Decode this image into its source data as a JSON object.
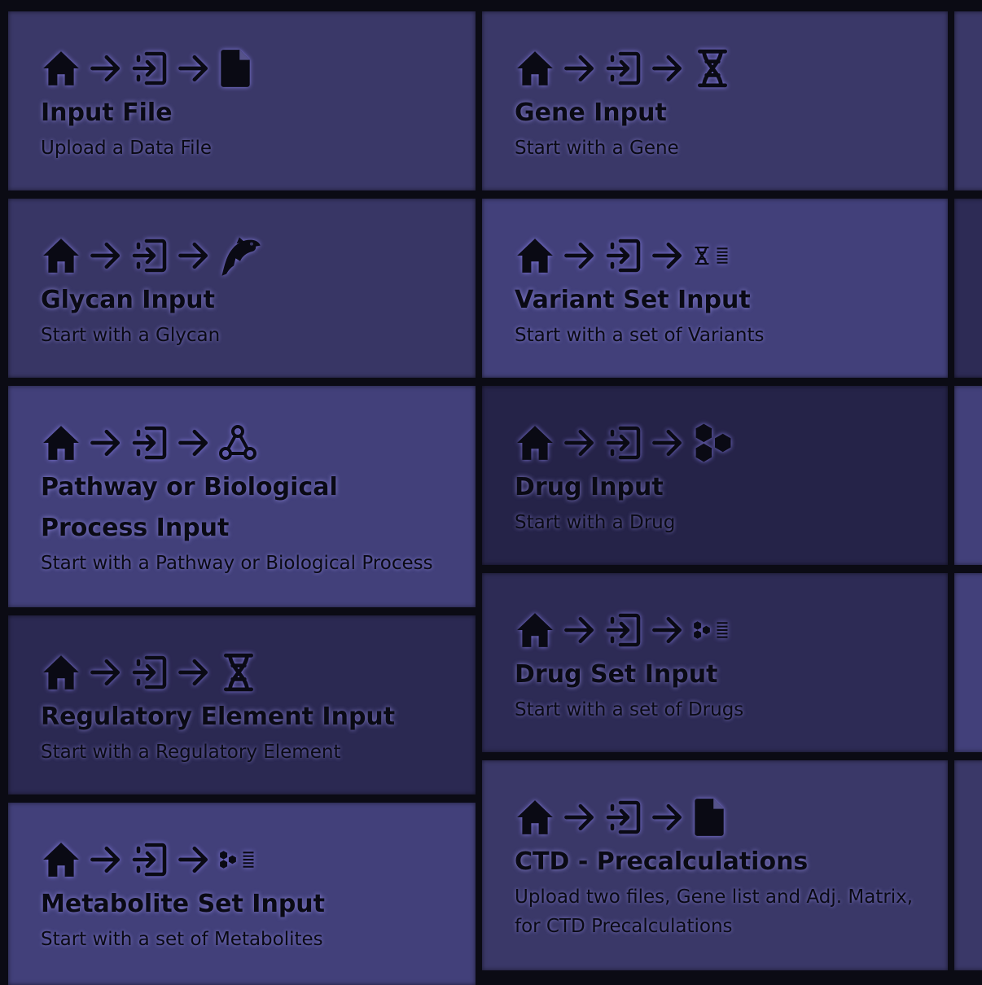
{
  "cards": [
    {
      "title": "Input File",
      "subtitle": "Upload a Data File",
      "icon": "file-icon"
    },
    {
      "title": "Glycan Input",
      "subtitle": "Start with a Glycan",
      "icon": "dolphin-icon"
    },
    {
      "title": "Pathway or Biological Process Input",
      "subtitle": "Start with a Pathway or Biological Process",
      "icon": "pathway-icon"
    },
    {
      "title": "Regulatory Element Input",
      "subtitle": "Start with a Regulatory Element",
      "icon": "dna-icon"
    },
    {
      "title": "Metabolite Set Input",
      "subtitle": "Start with a set of Metabolites",
      "icon": "molecule-set-icon"
    },
    {
      "title": "Gene Input",
      "subtitle": "Start with a Gene",
      "icon": "dna-icon"
    },
    {
      "title": "Variant Set Input",
      "subtitle": "Start with a set of Variants",
      "icon": "dna-set-icon"
    },
    {
      "title": "Drug Input",
      "subtitle": "Start with a Drug",
      "icon": "molecule-icon"
    },
    {
      "title": "Drug Set Input",
      "subtitle": "Start with a set of Drugs",
      "icon": "molecule-set-icon"
    },
    {
      "title": "CTD - Precalculations",
      "subtitle": "Upload two files, Gene list and Adj. Matrix, for CTD Precalculations",
      "icon": "file-icon"
    }
  ],
  "path_icons": [
    "home-icon",
    "arrow-right-icon",
    "input-icon",
    "arrow-right-icon"
  ],
  "colors": {
    "glow": "#9c8cff",
    "text": "#0a0a14",
    "background": "#0b0b14"
  }
}
